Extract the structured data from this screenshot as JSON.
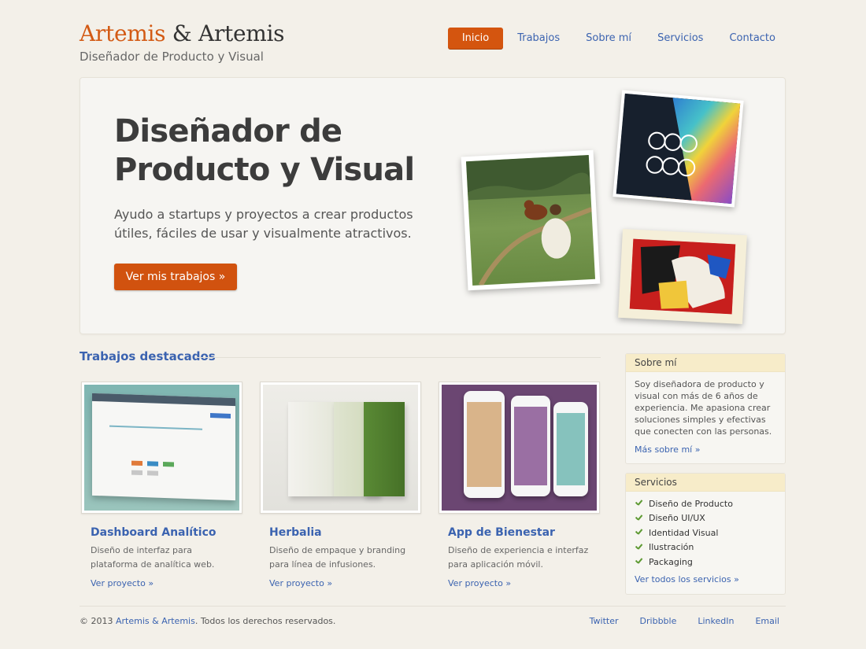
{
  "brand": {
    "name_accent": "Artemis",
    "name_rest": " & Artemis",
    "subtitle": "Diseñador de Producto y Visual"
  },
  "nav": {
    "items": [
      {
        "label": "Inicio",
        "active": true
      },
      {
        "label": "Trabajos"
      },
      {
        "label": "Sobre mí"
      },
      {
        "label": "Servicios"
      },
      {
        "label": "Contacto"
      }
    ]
  },
  "hero": {
    "title": "Diseñador de Producto y Visual",
    "text": "Ayudo a startups y proyectos a crear productos útiles, fáciles de usar y visualmente atractivos.",
    "button": "Ver mis trabajos »"
  },
  "featured": {
    "title": "Trabajos destacados",
    "cards": [
      {
        "title": "Dashboard Analítico",
        "desc": "Diseño de interfaz para plataforma de analítica web.",
        "link": "Ver proyecto »"
      },
      {
        "title": "Herbalia",
        "desc": "Diseño de empaque y branding para línea de infusiones.",
        "link": "Ver proyecto »"
      },
      {
        "title": "App de Bienestar",
        "desc": "Diseño de experiencia e interfaz para aplicación móvil.",
        "link": "Ver proyecto »"
      }
    ]
  },
  "sidebar": {
    "about": {
      "title": "Sobre mí",
      "text": "Soy diseñadora de producto y visual con más de 6 años de experiencia. Me apasiona crear soluciones simples y efectivas que conecten con las personas.",
      "link": "Más sobre mí »"
    },
    "services": {
      "title": "Servicios",
      "items": [
        "Diseño de Producto",
        "Diseño UI/UX",
        "Identidad Visual",
        "Ilustración",
        "Packaging"
      ],
      "link": "Ver todos los servicios »"
    }
  },
  "footer": {
    "copy_pre": "© 2013 ",
    "copy_link": "Artemis & Artemis",
    "copy_post": ". Todos los derechos reservados.",
    "links": [
      "Twitter",
      "Dribbble",
      "LinkedIn",
      "Email"
    ]
  },
  "colors": {
    "accent": "#d4550f",
    "link": "#3b63b0",
    "background": "#f3f0e9"
  }
}
